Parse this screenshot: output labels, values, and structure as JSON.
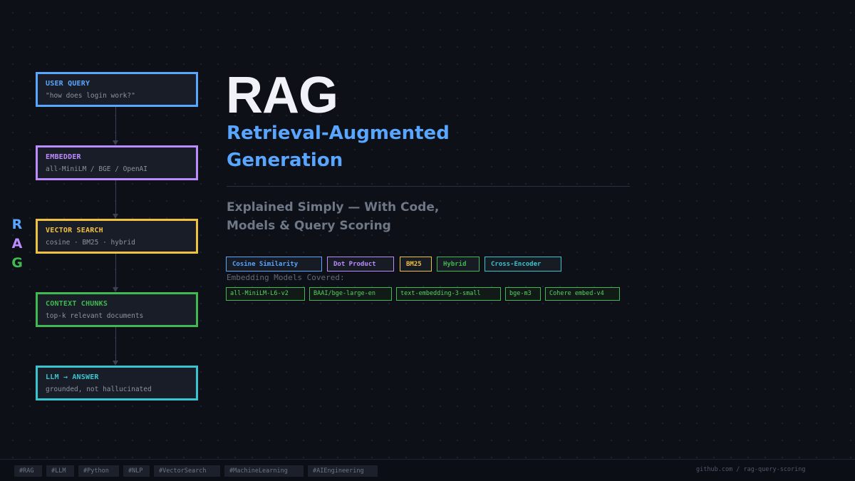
{
  "pipeline": [
    {
      "title": "USER QUERY",
      "subtitle": "\"how does login work?\"",
      "color": "#58a6ff"
    },
    {
      "title": "EMBEDDER",
      "subtitle": "all-MiniLM / BGE / OpenAI",
      "color": "#bc8cff"
    },
    {
      "title": "VECTOR SEARCH",
      "subtitle": "cosine · BM25 · hybrid",
      "color": "#f0c040"
    },
    {
      "title": "CONTEXT CHUNKS",
      "subtitle": "top-k relevant documents",
      "color": "#3fb950"
    },
    {
      "title": "LLM  →  ANSWER",
      "subtitle": "grounded, not hallucinated",
      "color": "#39c5cf"
    }
  ],
  "side_letters": [
    {
      "char": "R",
      "color": "#58a6ff"
    },
    {
      "char": "A",
      "color": "#bc8cff"
    },
    {
      "char": "G",
      "color": "#3fb950"
    }
  ],
  "hero": {
    "title": "RAG",
    "subtitle_line1": "Retrieval-Augmented",
    "subtitle_line2": "Generation",
    "tagline_line1": "Explained Simply — With Code,",
    "tagline_line2": "Models & Query Scoring"
  },
  "scoring_methods": [
    {
      "label": "Cosine Similarity",
      "color": "#58a6ff"
    },
    {
      "label": "Dot Product",
      "color": "#bc8cff"
    },
    {
      "label": "BM25",
      "color": "#f0c040"
    },
    {
      "label": "Hybrid",
      "color": "#3fb950"
    },
    {
      "label": "Cross-Encoder",
      "color": "#39c5cf"
    }
  ],
  "models_label": "Embedding Models Covered:",
  "models": [
    "all-MiniLM-L6-v2",
    "BAAI/bge-large-en",
    "text-embedding-3-small",
    "bge-m3",
    "Cohere embed-v4"
  ],
  "footer": {
    "hashtags": [
      "#RAG",
      "#LLM",
      "#Python",
      "#NLP",
      "#VectorSearch",
      "#MachineLearning",
      "#AIEngineering"
    ],
    "repo": "github.com / rag-query-scoring"
  }
}
